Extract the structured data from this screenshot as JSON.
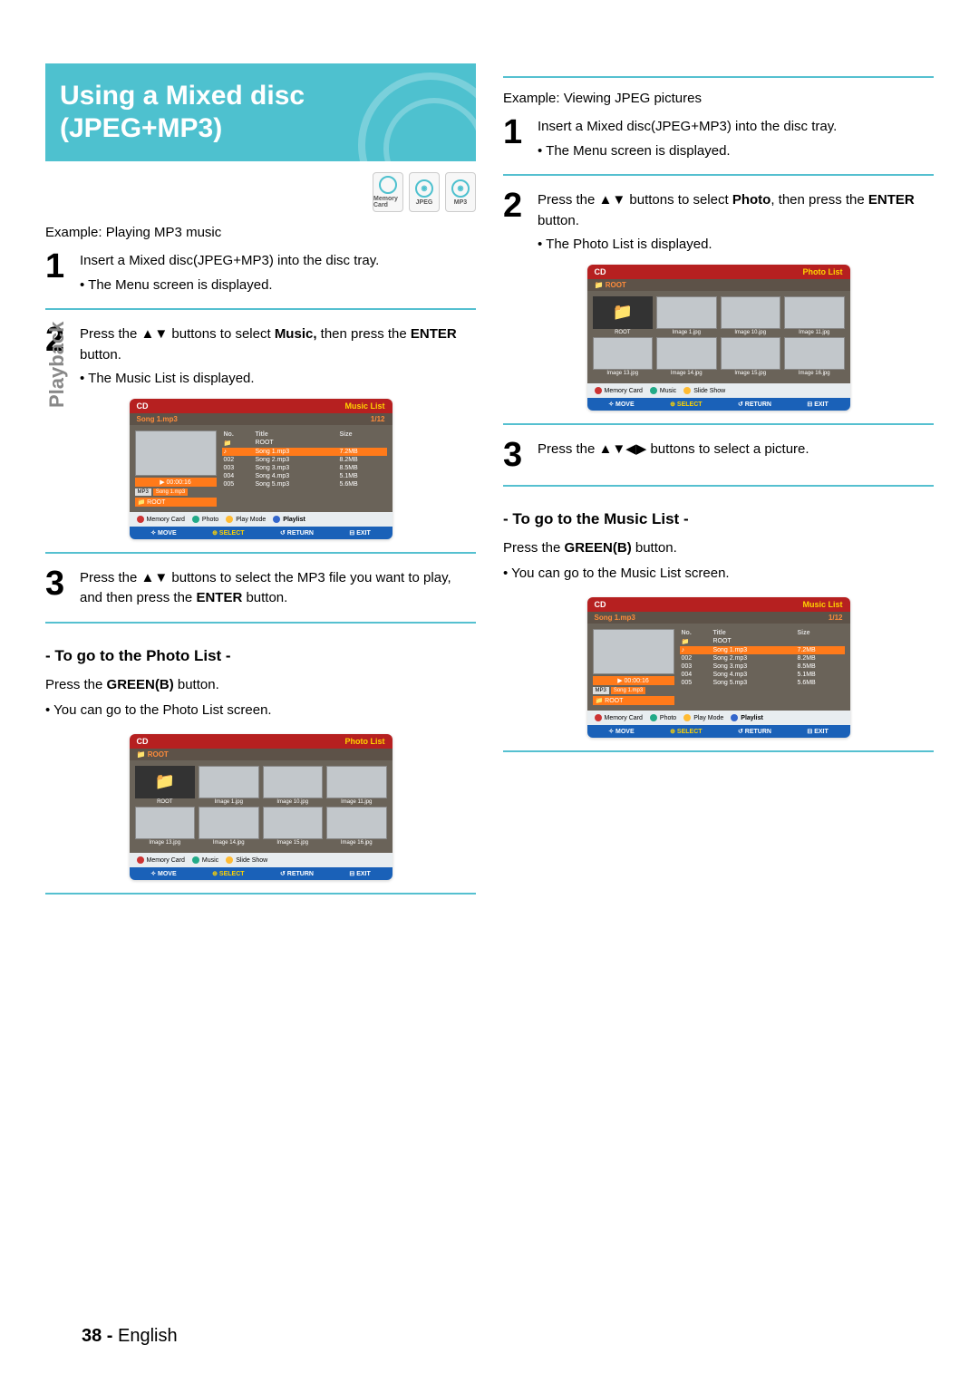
{
  "sideTab": "Playback",
  "title": "Using a Mixed disc (JPEG+MP3)",
  "iconChips": [
    "Memory Card",
    "JPEG",
    "MP3"
  ],
  "left": {
    "example": "Example: Playing MP3 music",
    "step1": {
      "num": "1",
      "line1": "Insert a Mixed disc(JPEG+MP3) into the disc tray.",
      "bullet": "The Menu screen is displayed."
    },
    "step2": {
      "num": "2",
      "pre": "Press the ",
      "arrows": "▲▼",
      "mid": " buttons to select ",
      "bold1": "Music,",
      "mid2": " then press the ",
      "bold2": "ENTER",
      "post": " button.",
      "bullet": "The Music List is displayed."
    },
    "step3": {
      "num": "3",
      "pre": "Press the ",
      "arrows": "▲▼",
      "mid": " buttons to select the MP3 file you want to play, and then press the ",
      "bold": "ENTER",
      "post": " button."
    },
    "subA": {
      "heading": "- To go to the Photo List -",
      "pre": "Press the ",
      "bold": "GREEN(B)",
      "post": " button.",
      "bullet": "You can go to the Photo List screen."
    }
  },
  "right": {
    "example": "Example: Viewing JPEG pictures",
    "step1": {
      "num": "1",
      "line1": "Insert a Mixed disc(JPEG+MP3) into the disc tray.",
      "bullet": "The Menu screen is displayed."
    },
    "step2": {
      "num": "2",
      "pre": "Press the ",
      "arrows": "▲▼",
      "mid": " buttons to select ",
      "bold1": "Photo",
      "mid2": ", then press the ",
      "bold2": "ENTER",
      "post": " button.",
      "bullet": "The Photo List is displayed."
    },
    "step3": {
      "num": "3",
      "pre": "Press the ",
      "arrows": "▲▼◀▶",
      "post": " buttons to select a picture."
    },
    "subA": {
      "heading": "- To go to the Music List -",
      "pre": "Press the ",
      "bold": "GREEN(B)",
      "post": " button.",
      "bullet": "You can go to the  Music List screen."
    }
  },
  "musicOsd": {
    "hLeft": "CD",
    "hRight": "Music List",
    "subLeft": "Song 1.mp3",
    "subRight": "1/12",
    "time": "00:00:16",
    "mp3": "MP3",
    "now": "Song 1.mp3",
    "root": "ROOT",
    "cols": [
      "No.",
      "Title",
      "Size"
    ],
    "rows": [
      {
        "no": "",
        "title": "ROOT",
        "size": ""
      },
      {
        "no": "",
        "title": "Song 1.mp3",
        "size": "7.2MB",
        "hl": true
      },
      {
        "no": "002",
        "title": "Song 2.mp3",
        "size": "8.2MB"
      },
      {
        "no": "003",
        "title": "Song 3.mp3",
        "size": "8.5MB"
      },
      {
        "no": "004",
        "title": "Song 4.mp3",
        "size": "5.1MB"
      },
      {
        "no": "005",
        "title": "Song 5.mp3",
        "size": "5.6MB"
      }
    ],
    "btns": [
      "Memory Card",
      "Photo",
      "Play Mode",
      "Playlist"
    ],
    "nav": [
      "MOVE",
      "SELECT",
      "RETURN",
      "EXIT"
    ]
  },
  "photoOsd": {
    "hLeft": "CD",
    "hRight": "Photo List",
    "root": "ROOT",
    "row1": [
      "ROOT",
      "Image 1.jpg",
      "Image 10.jpg",
      "Image 11.jpg"
    ],
    "row2": [
      "Image 13.jpg",
      "Image 14.jpg",
      "Image 15.jpg",
      "Image 16.jpg"
    ],
    "btns": [
      "Memory Card",
      "Music",
      "Slide Show"
    ],
    "nav": [
      "MOVE",
      "SELECT",
      "RETURN",
      "EXIT"
    ]
  },
  "footer": {
    "page": "38 -",
    "lang": "English"
  }
}
